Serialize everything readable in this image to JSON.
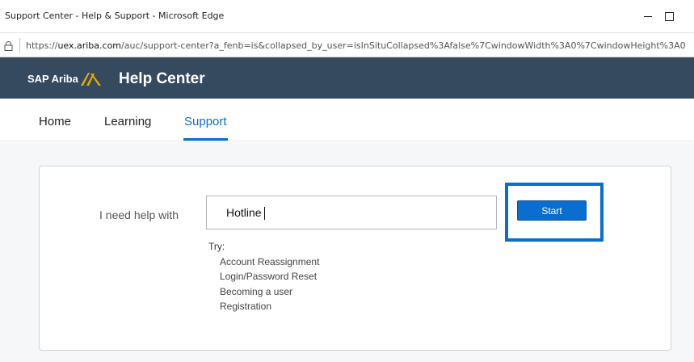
{
  "window": {
    "title": "Support Center - Help & Support - Microsoft Edge",
    "url_prefix": "https://",
    "url_host": "uex.ariba.com",
    "url_rest": "/auc/support-center?a_fenb=is&collapsed_by_user=isInSituCollapsed%3Afalse%7CwindowWidth%3A0%7CwindowHeight%3A0"
  },
  "header": {
    "brand": "SAP Ariba",
    "title": "Help Center",
    "brand_color": "#f0ab00",
    "bg_color": "#354a5f"
  },
  "nav": {
    "items": [
      {
        "label": "Home"
      },
      {
        "label": "Learning"
      },
      {
        "label": "Support",
        "active": true
      }
    ]
  },
  "search": {
    "label": "I need help with",
    "value": "Hotline",
    "button_label": "Start"
  },
  "suggestions": {
    "heading": "Try:",
    "items": [
      "Account Reassignment",
      "Login/Password Reset",
      "Becoming a user",
      "Registration"
    ]
  }
}
